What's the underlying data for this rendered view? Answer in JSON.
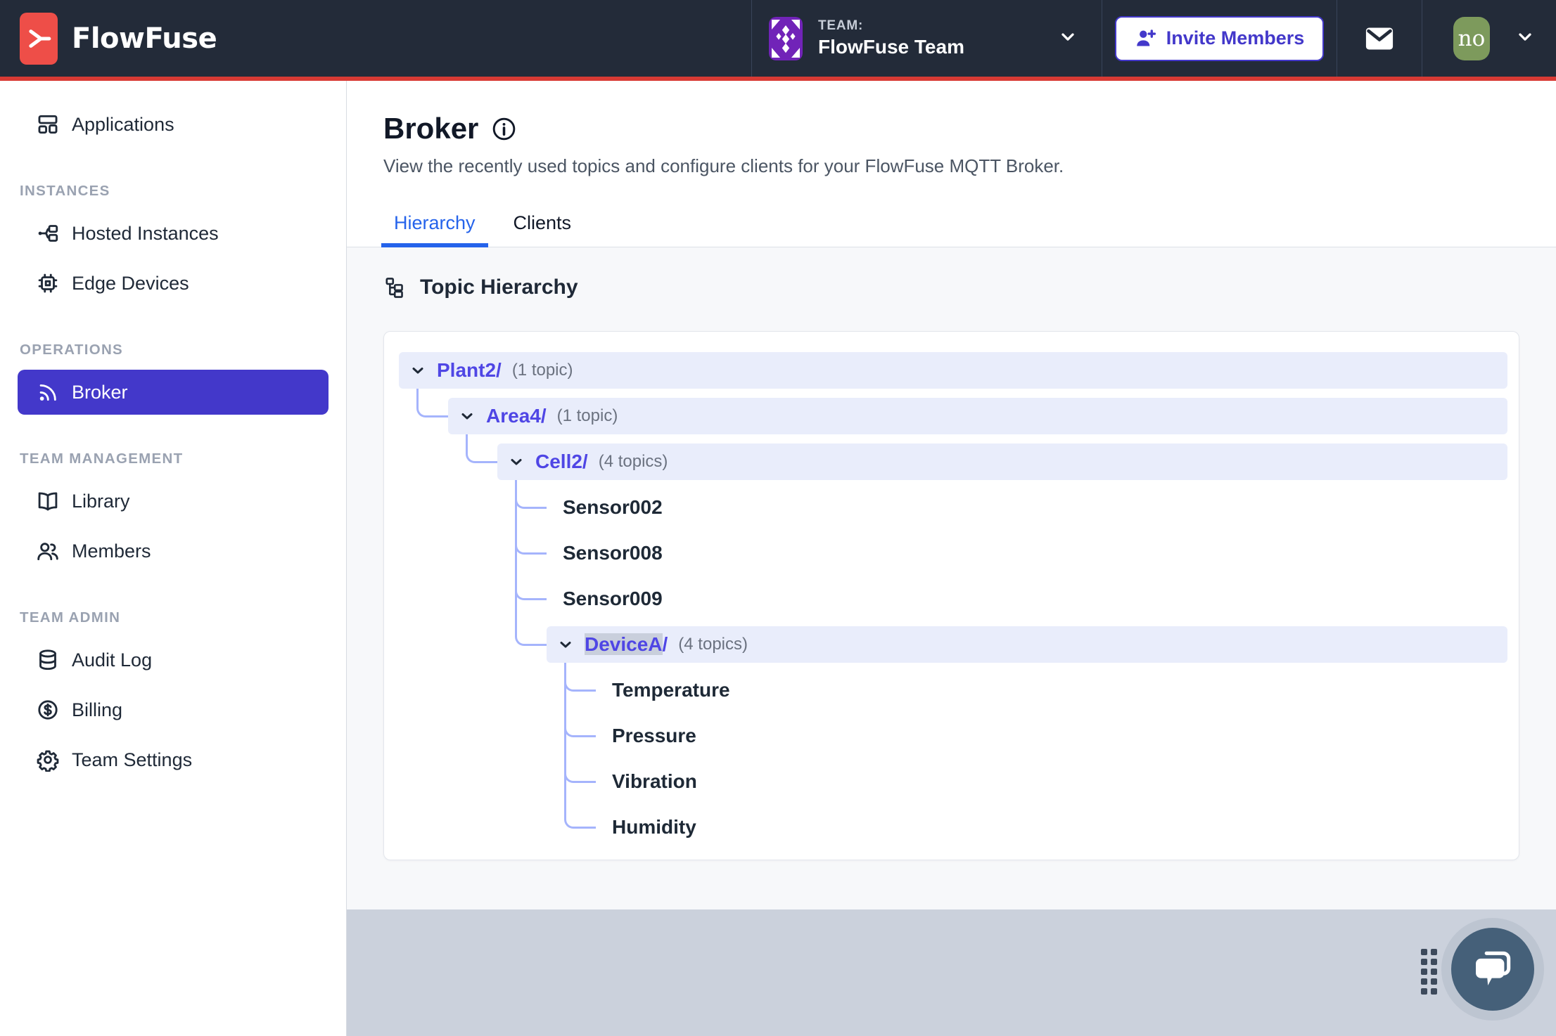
{
  "colors": {
    "navbar_bg": "#232B39",
    "accent_red": "#D83A34",
    "logo_red": "#EE4E48",
    "indigo_primary": "#4338CA",
    "tree_label_indigo": "#4F46E5",
    "tree_row_bg": "#E9EDFB",
    "connector": "#A5B4FC",
    "tab_active_blue": "#2563EB",
    "footer_gray": "#CBD1DC",
    "chat_slate": "#456079",
    "avatar_green": "#7D9A5C",
    "avatar_purple": "#7123B8"
  },
  "navbar": {
    "logo_text": "FlowFuse",
    "team_label": "TEAM:",
    "team_name": "FlowFuse Team",
    "invite_button": "Invite Members",
    "user_avatar_text": "no"
  },
  "sidebar": {
    "sections": [
      {
        "header": null,
        "items": [
          {
            "label": "Applications",
            "icon": "applications-icon",
            "active": false
          }
        ]
      },
      {
        "header": "INSTANCES",
        "items": [
          {
            "label": "Hosted Instances",
            "icon": "hosted-instances-icon",
            "active": false
          },
          {
            "label": "Edge Devices",
            "icon": "edge-devices-icon",
            "active": false
          }
        ]
      },
      {
        "header": "OPERATIONS",
        "items": [
          {
            "label": "Broker",
            "icon": "broker-icon",
            "active": true
          }
        ]
      },
      {
        "header": "TEAM MANAGEMENT",
        "items": [
          {
            "label": "Library",
            "icon": "library-icon",
            "active": false
          },
          {
            "label": "Members",
            "icon": "members-icon",
            "active": false
          }
        ]
      },
      {
        "header": "TEAM ADMIN",
        "items": [
          {
            "label": "Audit Log",
            "icon": "audit-log-icon",
            "active": false
          },
          {
            "label": "Billing",
            "icon": "billing-icon",
            "active": false
          },
          {
            "label": "Team Settings",
            "icon": "team-settings-icon",
            "active": false
          }
        ]
      }
    ]
  },
  "page": {
    "title": "Broker",
    "description": "View the recently used topics and configure clients for your FlowFuse MQTT Broker.",
    "tabs": [
      {
        "label": "Hierarchy",
        "active": true
      },
      {
        "label": "Clients",
        "active": false
      }
    ],
    "section_title": "Topic Hierarchy"
  },
  "tree": {
    "nodes": [
      {
        "label": "Plant2",
        "suffix": "/",
        "count": "(1 topic)",
        "level": 0,
        "expandable": true,
        "parent": null,
        "highlighted": false
      },
      {
        "label": "Area4",
        "suffix": "/",
        "count": "(1 topic)",
        "level": 1,
        "expandable": true,
        "parent": 0,
        "highlighted": false
      },
      {
        "label": "Cell2",
        "suffix": "/",
        "count": "(4 topics)",
        "level": 2,
        "expandable": true,
        "parent": 1,
        "highlighted": false
      },
      {
        "label": "Sensor002",
        "suffix": "",
        "count": "",
        "level": 3,
        "expandable": false,
        "parent": 2,
        "highlighted": false
      },
      {
        "label": "Sensor008",
        "suffix": "",
        "count": "",
        "level": 3,
        "expandable": false,
        "parent": 2,
        "highlighted": false
      },
      {
        "label": "Sensor009",
        "suffix": "",
        "count": "",
        "level": 3,
        "expandable": false,
        "parent": 2,
        "highlighted": false
      },
      {
        "label": "DeviceA",
        "suffix": "/",
        "count": "(4 topics)",
        "level": 3,
        "expandable": true,
        "parent": 2,
        "highlighted": true
      },
      {
        "label": "Temperature",
        "suffix": "",
        "count": "",
        "level": 4,
        "expandable": false,
        "parent": 6,
        "highlighted": false
      },
      {
        "label": "Pressure",
        "suffix": "",
        "count": "",
        "level": 4,
        "expandable": false,
        "parent": 6,
        "highlighted": false
      },
      {
        "label": "Vibration",
        "suffix": "",
        "count": "",
        "level": 4,
        "expandable": false,
        "parent": 6,
        "highlighted": false
      },
      {
        "label": "Humidity",
        "suffix": "",
        "count": "",
        "level": 4,
        "expandable": false,
        "parent": 6,
        "highlighted": false
      }
    ]
  }
}
